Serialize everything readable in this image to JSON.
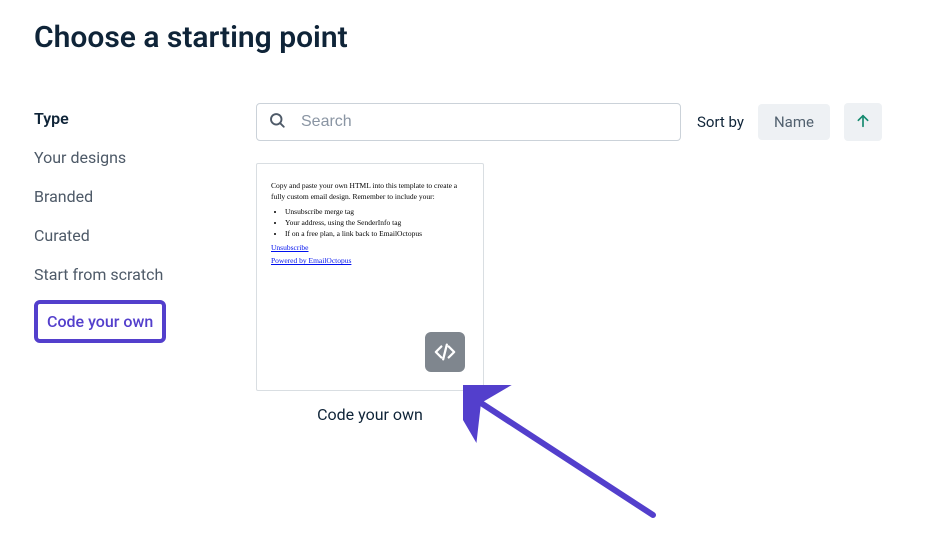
{
  "header": {
    "title": "Choose a starting point"
  },
  "sidebar": {
    "heading": "Type",
    "items": [
      {
        "label": "Your designs"
      },
      {
        "label": "Branded"
      },
      {
        "label": "Curated"
      },
      {
        "label": "Start from scratch"
      },
      {
        "label": "Code your own",
        "selected": true
      }
    ]
  },
  "search": {
    "placeholder": "Search",
    "value": ""
  },
  "sort": {
    "label": "Sort by",
    "value": "Name",
    "direction": "asc"
  },
  "cards": [
    {
      "title": "Code your own",
      "preview": {
        "intro": "Copy and paste your own HTML into this template to create a fully custom email design. Remember to include your:",
        "bullets": [
          "Unsubscribe merge tag",
          "Your address, using the SenderInfo tag",
          "If on a free plan, a link back to EmailOctopus"
        ],
        "links": [
          "Unsubscribe",
          "Powered by EmailOctopus"
        ]
      }
    }
  ],
  "colors": {
    "accent": "#533fcc",
    "sortArrow": "#158a6f"
  }
}
